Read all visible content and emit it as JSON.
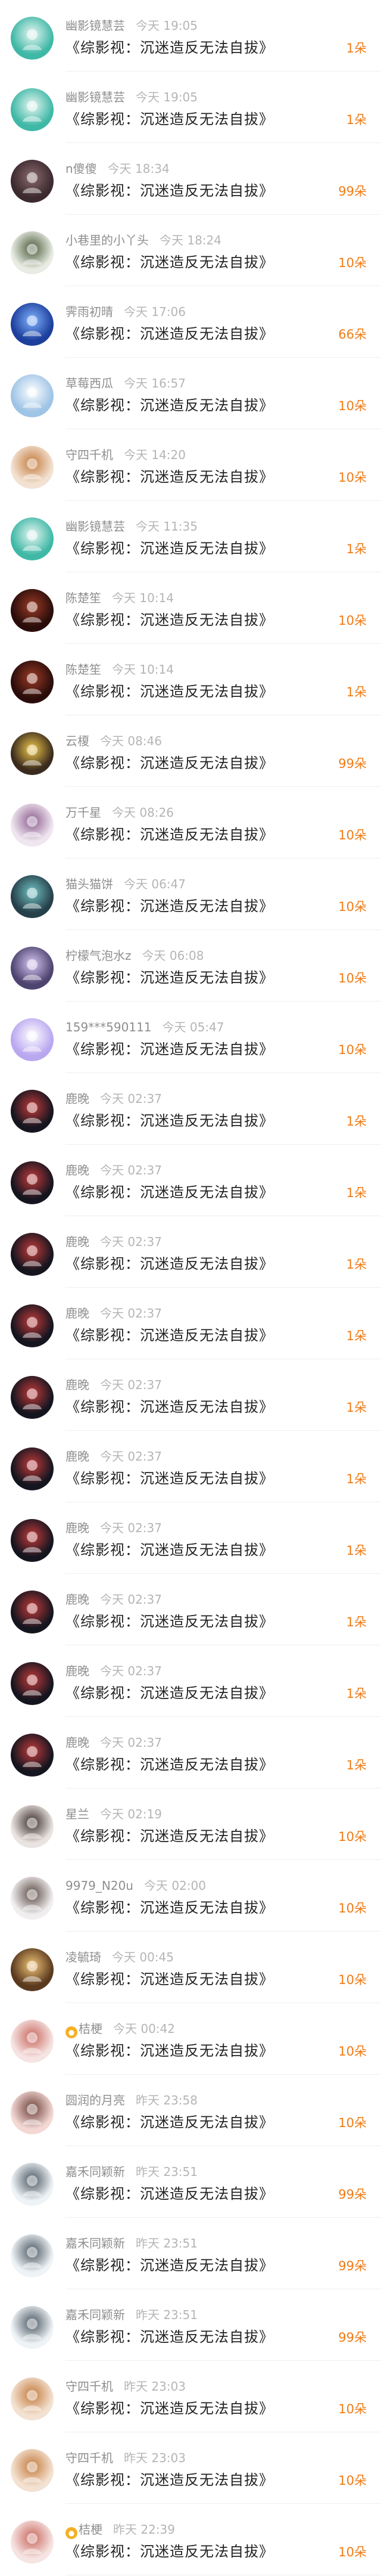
{
  "records": [
    {
      "name": "幽影镜慧芸",
      "time": "今天 19:05",
      "title": "《综影视：沉迷造反无法自拔》",
      "amount": "1朵",
      "avatar": {
        "icon": "anime-girl-teal-hair-icon",
        "bg": "#3fb8a6",
        "fg": "#e9f6f3"
      }
    },
    {
      "name": "幽影镜慧芸",
      "time": "今天 19:05",
      "title": "《综影视：沉迷造反无法自拔》",
      "amount": "1朵",
      "avatar": {
        "icon": "anime-girl-teal-hair-icon",
        "bg": "#3fb8a6",
        "fg": "#e9f6f3"
      }
    },
    {
      "name": "n傻傻",
      "time": "今天 18:34",
      "title": "《综影视：沉迷造反无法自拔》",
      "amount": "99朵",
      "avatar": {
        "icon": "dark-portrait-icon",
        "bg": "#3b2a2e",
        "fg": "#8a6a6f"
      }
    },
    {
      "name": "小巷里的小丫头",
      "time": "今天 18:24",
      "title": "《综影视：沉迷造反无法自拔》",
      "amount": "10朵",
      "avatar": {
        "icon": "cartoon-girl-icon",
        "bg": "#e8ece3",
        "fg": "#4a5a3a"
      }
    },
    {
      "name": "霁雨初晴",
      "time": "今天 17:06",
      "title": "《综影视：沉迷造反无法自拔》",
      "amount": "66朵",
      "avatar": {
        "icon": "blue-flower-icon",
        "bg": "#1d3f9c",
        "fg": "#7fb2ff"
      }
    },
    {
      "name": "草莓西瓜",
      "time": "今天 16:57",
      "title": "《综影视：沉迷造反无法自拔》",
      "amount": "10朵",
      "avatar": {
        "icon": "sky-person-icon",
        "bg": "#9ec4e6",
        "fg": "#ffffff"
      }
    },
    {
      "name": "守四千机",
      "time": "今天 14:20",
      "title": "《综影视：沉迷造反无法自拔》",
      "amount": "10朵",
      "avatar": {
        "icon": "cartoon-cat-icon",
        "bg": "#f3e2d2",
        "fg": "#c47a3c"
      }
    },
    {
      "name": "幽影镜慧芸",
      "time": "今天 11:35",
      "title": "《综影视：沉迷造反无法自拔》",
      "amount": "1朵",
      "avatar": {
        "icon": "anime-girl-teal-hair-icon",
        "bg": "#3fb8a6",
        "fg": "#e9f6f3"
      }
    },
    {
      "name": "陈楚笙",
      "time": "今天 10:14",
      "title": "《综影视：沉迷造反无法自拔》",
      "amount": "10朵",
      "avatar": {
        "icon": "dark-red-portrait-icon",
        "bg": "#2a0d0b",
        "fg": "#9b3a24"
      }
    },
    {
      "name": "陈楚笙",
      "time": "今天 10:14",
      "title": "《综影视：沉迷造反无法自拔》",
      "amount": "1朵",
      "avatar": {
        "icon": "dark-red-portrait-icon",
        "bg": "#2a0d0b",
        "fg": "#9b3a24"
      }
    },
    {
      "name": "云榎",
      "time": "今天 08:46",
      "title": "《综影视：沉迷造反无法自拔》",
      "amount": "99朵",
      "avatar": {
        "icon": "yellow-anime-icon",
        "bg": "#3a2b1e",
        "fg": "#f1c84a"
      }
    },
    {
      "name": "万千星",
      "time": "今天 08:26",
      "title": "《综影视：沉迷造反无法自拔》",
      "amount": "10朵",
      "avatar": {
        "icon": "anime-girl-pink-icon",
        "bg": "#efe6ef",
        "fg": "#8b5c8f"
      }
    },
    {
      "name": "猫头猫饼",
      "time": "今天 06:47",
      "title": "《综影视：沉迷造反无法自拔》",
      "amount": "10朵",
      "avatar": {
        "icon": "teal-fantasy-icon",
        "bg": "#26404a",
        "fg": "#71c2c4"
      }
    },
    {
      "name": "柠檬气泡水z",
      "time": "今天 06:08",
      "title": "《综影视：沉迷造反无法自拔》",
      "amount": "10朵",
      "avatar": {
        "icon": "purple-anime-icon",
        "bg": "#4e4470",
        "fg": "#d6c6f2"
      }
    },
    {
      "name": "159***590111",
      "time": "今天 05:47",
      "title": "《综影视：沉迷造反无法自拔》",
      "amount": "10朵",
      "avatar": {
        "icon": "chat-bubble-icon",
        "bg": "#b9a7f0",
        "fg": "#ffffff"
      }
    },
    {
      "name": "鹿晚",
      "time": "今天 02:37",
      "title": "《综影视：沉迷造反无法自拔》",
      "amount": "1朵",
      "avatar": {
        "icon": "dark-anime-icon",
        "bg": "#14151f",
        "fg": "#c23a3a"
      }
    },
    {
      "name": "鹿晚",
      "time": "今天 02:37",
      "title": "《综影视：沉迷造反无法自拔》",
      "amount": "1朵",
      "avatar": {
        "icon": "dark-anime-icon",
        "bg": "#14151f",
        "fg": "#c23a3a"
      }
    },
    {
      "name": "鹿晚",
      "time": "今天 02:37",
      "title": "《综影视：沉迷造反无法自拔》",
      "amount": "1朵",
      "avatar": {
        "icon": "dark-anime-icon",
        "bg": "#14151f",
        "fg": "#c23a3a"
      }
    },
    {
      "name": "鹿晚",
      "time": "今天 02:37",
      "title": "《综影视：沉迷造反无法自拔》",
      "amount": "1朵",
      "avatar": {
        "icon": "dark-anime-icon",
        "bg": "#14151f",
        "fg": "#c23a3a"
      }
    },
    {
      "name": "鹿晚",
      "time": "今天 02:37",
      "title": "《综影视：沉迷造反无法自拔》",
      "amount": "1朵",
      "avatar": {
        "icon": "dark-anime-icon",
        "bg": "#14151f",
        "fg": "#c23a3a"
      }
    },
    {
      "name": "鹿晚",
      "time": "今天 02:37",
      "title": "《综影视：沉迷造反无法自拔》",
      "amount": "1朵",
      "avatar": {
        "icon": "dark-anime-icon",
        "bg": "#14151f",
        "fg": "#c23a3a"
      }
    },
    {
      "name": "鹿晚",
      "time": "今天 02:37",
      "title": "《综影视：沉迷造反无法自拔》",
      "amount": "1朵",
      "avatar": {
        "icon": "dark-anime-icon",
        "bg": "#14151f",
        "fg": "#c23a3a"
      }
    },
    {
      "name": "鹿晚",
      "time": "今天 02:37",
      "title": "《综影视：沉迷造反无法自拔》",
      "amount": "1朵",
      "avatar": {
        "icon": "dark-anime-icon",
        "bg": "#14151f",
        "fg": "#c23a3a"
      }
    },
    {
      "name": "鹿晚",
      "time": "今天 02:37",
      "title": "《综影视：沉迷造反无法自拔》",
      "amount": "1朵",
      "avatar": {
        "icon": "dark-anime-icon",
        "bg": "#14151f",
        "fg": "#c23a3a"
      }
    },
    {
      "name": "鹿晚",
      "time": "今天 02:37",
      "title": "《综影视：沉迷造反无法自拔》",
      "amount": "1朵",
      "avatar": {
        "icon": "dark-anime-icon",
        "bg": "#14151f",
        "fg": "#c23a3a"
      }
    },
    {
      "name": "星兰",
      "time": "今天 02:19",
      "title": "《综影视：沉迷造反无法自拔》",
      "amount": "10朵",
      "avatar": {
        "icon": "girl-photo-icon",
        "bg": "#e9e4e1",
        "fg": "#3a2c29"
      }
    },
    {
      "name": "9979_N20u",
      "time": "今天 02:00",
      "title": "《综影视：沉迷造反无法自拔》",
      "amount": "10朵",
      "avatar": {
        "icon": "girl-white-bg-icon",
        "bg": "#f0eeee",
        "fg": "#5b4a44"
      }
    },
    {
      "name": "凌毓琦",
      "time": "今天 00:45",
      "title": "《综影视：沉迷造反无法自拔》",
      "amount": "10朵",
      "avatar": {
        "icon": "heart-hands-icon",
        "bg": "#5a3a1f",
        "fg": "#f2c476"
      }
    },
    {
      "name": "桔梗",
      "time": "今天 00:42",
      "title": "《综影视：沉迷造反无法自拔》",
      "amount": "10朵",
      "crown": true,
      "avatar": {
        "icon": "cartoon-girl-pink-icon",
        "bg": "#f6e4e2",
        "fg": "#c8665d"
      }
    },
    {
      "name": "圆润的月亮",
      "time": "昨天 23:58",
      "title": "《综影视：沉迷造反无法自拔》",
      "amount": "10朵",
      "avatar": {
        "icon": "girl-face-icon",
        "bg": "#f3d8d4",
        "fg": "#6d3f38"
      }
    },
    {
      "name": "嘉禾同颖新",
      "time": "昨天 23:51",
      "title": "《综影视：沉迷造反无法自拔》",
      "amount": "99朵",
      "avatar": {
        "icon": "girl-portrait-icon",
        "bg": "#eef3f6",
        "fg": "#4a5660"
      }
    },
    {
      "name": "嘉禾同颖新",
      "time": "昨天 23:51",
      "title": "《综影视：沉迷造反无法自拔》",
      "amount": "99朵",
      "avatar": {
        "icon": "girl-portrait-icon",
        "bg": "#eef3f6",
        "fg": "#4a5660"
      }
    },
    {
      "name": "嘉禾同颖新",
      "time": "昨天 23:51",
      "title": "《综影视：沉迷造反无法自拔》",
      "amount": "99朵",
      "avatar": {
        "icon": "girl-portrait-icon",
        "bg": "#eef3f6",
        "fg": "#4a5660"
      }
    },
    {
      "name": "守四千机",
      "time": "昨天 23:03",
      "title": "《综影视：沉迷造反无法自拔》",
      "amount": "10朵",
      "avatar": {
        "icon": "cartoon-cat-icon",
        "bg": "#f3e2d2",
        "fg": "#c47a3c"
      }
    },
    {
      "name": "守四千机",
      "time": "昨天 23:03",
      "title": "《综影视：沉迷造反无法自拔》",
      "amount": "10朵",
      "avatar": {
        "icon": "cartoon-cat-icon",
        "bg": "#f3e2d2",
        "fg": "#c47a3c"
      }
    },
    {
      "name": "桔梗",
      "time": "昨天 22:39",
      "title": "《综影视：沉迷造反无法自拔》",
      "amount": "10朵",
      "crown": true,
      "avatar": {
        "icon": "cartoon-girl-pink-icon",
        "bg": "#f6e4e2",
        "fg": "#c8665d"
      }
    }
  ],
  "colors": {
    "amount": "#f07b16",
    "title": "#222222",
    "meta": "#a3a3a3",
    "divider": "#efefef"
  }
}
